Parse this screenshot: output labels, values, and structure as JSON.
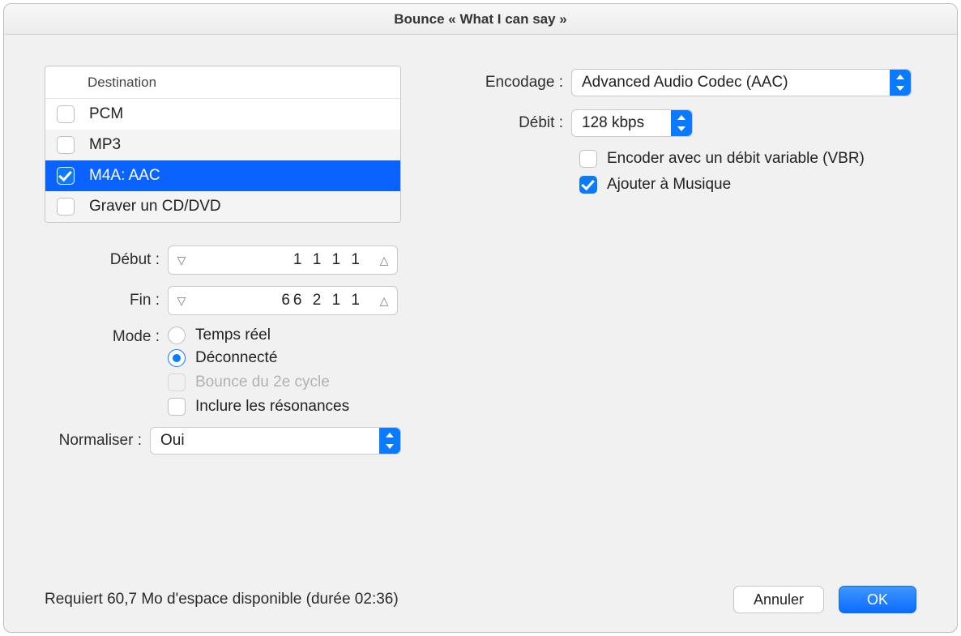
{
  "title": "Bounce « What I can say »",
  "destination": {
    "header": "Destination",
    "items": [
      {
        "label": "PCM",
        "checked": false,
        "selected": false
      },
      {
        "label": "MP3",
        "checked": false,
        "selected": false
      },
      {
        "label": "M4A: AAC",
        "checked": true,
        "selected": true
      },
      {
        "label": "Graver un CD/DVD",
        "checked": false,
        "selected": false
      }
    ]
  },
  "range": {
    "start_label": "Début :",
    "start_value": "1  1  1     1",
    "end_label": "Fin :",
    "end_value": "66  2  1     1"
  },
  "mode": {
    "label": "Mode :",
    "options": {
      "realtime": "Temps réel",
      "offline": "Déconnecté"
    },
    "selected": "offline",
    "second_cycle": {
      "label": "Bounce du 2e cycle",
      "checked": false,
      "enabled": false
    },
    "include_tails": {
      "label": "Inclure les résonances",
      "checked": false,
      "enabled": true
    }
  },
  "normalize": {
    "label": "Normaliser :",
    "value": "Oui"
  },
  "encoding": {
    "label": "Encodage :",
    "value": "Advanced Audio Codec (AAC)"
  },
  "bitrate": {
    "label": "Débit :",
    "value": "128 kbps"
  },
  "vbr": {
    "label": "Encoder avec un débit variable (VBR)",
    "checked": false
  },
  "add_to_music": {
    "label": "Ajouter à Musique",
    "checked": true
  },
  "footer": {
    "status": "Requiert 60,7 Mo d'espace disponible (durée 02:36)",
    "cancel": "Annuler",
    "ok": "OK"
  }
}
